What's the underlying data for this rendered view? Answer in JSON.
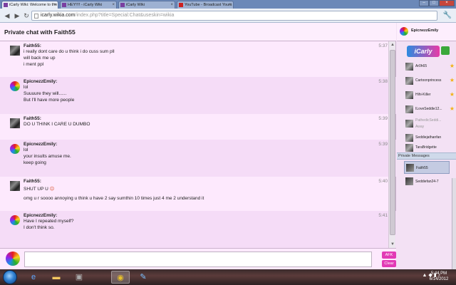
{
  "browser": {
    "tabs": [
      {
        "title": "iCarly Wiki: Welcome to the",
        "active": true
      },
      {
        "title": "HEY!!!! - iCarly Wiki",
        "active": false
      },
      {
        "title": "iCarly Wiki",
        "active": false
      },
      {
        "title": "YouTube - Broadcast Yours",
        "active": false
      }
    ],
    "url_host": "icarly.wikia.com",
    "url_path": "/index.php?title=Special:Chat&useskin=wikia"
  },
  "chat": {
    "title": "Private chat with Faith55",
    "messages": [
      {
        "user": "Faith55:",
        "time": "5:37",
        "avatar": "faith",
        "lines": [
          "i really dont care do u think i do cuss sum pll",
          "will back me up",
          "i ment ppl"
        ]
      },
      {
        "user": "EpicnezzEmily:",
        "time": "5:38",
        "avatar": "emily",
        "lines": [
          "lol",
          "Suuuure they will......",
          "But I'll have more people"
        ]
      },
      {
        "user": "Faith55:",
        "time": "5:39",
        "avatar": "faith",
        "lines": [
          "DO U THINK I CARE U DUMBO"
        ]
      },
      {
        "user": "EpicnezzEmily:",
        "time": "5:39",
        "avatar": "emily",
        "lines": [
          "lol",
          "your insults amuse me.",
          "keep going"
        ]
      },
      {
        "user": "Faith55:",
        "time": "5:40",
        "avatar": "faith",
        "lines": [
          "SHUT UP U",
          "omg u r soooo annoying u think u have 2 say sumthin 10 times just 4 me 2 understand it"
        ]
      },
      {
        "user": "EpicnezzEmily:",
        "time": "5:41",
        "avatar": "emily",
        "lines": [
          "Have I repeated myself?",
          "I don't think so."
        ]
      }
    ],
    "input_value": "",
    "afk_label": "AFK",
    "clear_label": "Clear"
  },
  "sidebar": {
    "me": "EpicnezzEmily",
    "logo_text": "iCarly",
    "users": [
      {
        "name": "Ar0h65",
        "star": true
      },
      {
        "name": "Cartoonprincess",
        "star": true
      },
      {
        "name": "Hihi-Killer",
        "star": true
      },
      {
        "name": "ILoveSeddie12...",
        "star": true
      },
      {
        "name": "PathedicSeddi...",
        "sub": "Away",
        "away": true
      },
      {
        "name": "Seddiejathanfan",
        "star": false
      },
      {
        "name": "TaraBridgette",
        "star": false
      }
    ],
    "pm_header": "Private Messages",
    "pms": [
      {
        "name": "Faith55",
        "active": true
      },
      {
        "name": "Seddiefan24-7",
        "active": false
      }
    ]
  },
  "taskbar": {
    "time": "5:44 PM",
    "date": "6/14/2012"
  },
  "colors": {
    "chat_bg": "#fde9fd",
    "alt_row": "#f5dcf7",
    "button_pink": "#e23ab5",
    "star": "#f2b215"
  },
  "icons": [
    "start-orb-icon",
    "ie-icon",
    "folder-icon",
    "chrome-icon",
    "paint-icon",
    "star-icon",
    "wrench-icon"
  ]
}
